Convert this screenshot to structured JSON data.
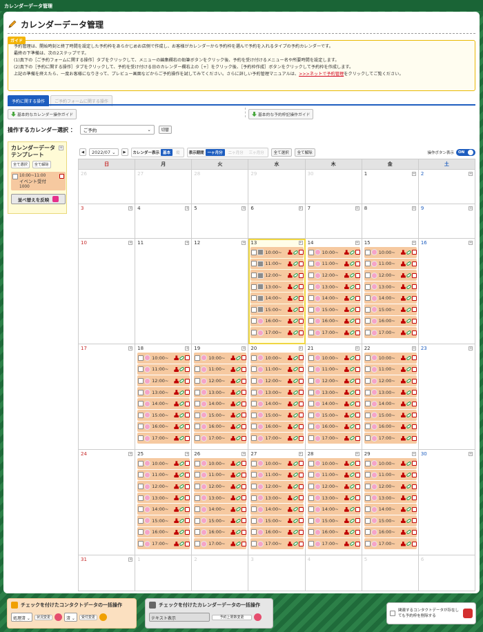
{
  "window": {
    "title": "カレンダーデータ管理"
  },
  "page": {
    "title": "カレンダーデータ管理"
  },
  "guide": {
    "tag": "ガイド",
    "lines": [
      "予約管理は、開始時刻と終了時間を設定した予約枠をあらかじめお店側で作成し、お客様がカレンダーから予約枠を選んで予約を入れるタイプの予約カレンダーです。",
      "最終の下準備は、次の2ステップです。",
      "(1)真下の［ご予約フォームに関する操作］タブをクリックして、メニューの編集欄右の鉛筆ボタンをクリック後、予約を受け付けるメニュー名や所要時間を設定します。",
      "(2)真下の［予約に関する操作］タブをクリックして、予約を受け付ける日のカレンダー欄右上の［+］をクリック後、［予約枠作成］ボタンをクリックして予約枠を作成します。"
    ],
    "last_pre": "上記の準備を終えたら、一度お客様になりきって、プレビュー画面などからご予約操作を試してみてください。さらに詳しい予約管理マニュアルは、",
    "last_link": ">>>ネットで予約管理",
    "last_post": "をクリックしてご覧ください。"
  },
  "tabs": [
    "予約に関する操作",
    "ご予約フォームに関する操作"
  ],
  "guides": {
    "left": "基本的なカレンダー操作ガイド",
    "right": "基本的な予約枠記操作ガイド"
  },
  "calendar_select": {
    "label": "操作するカレンダー選択 ：",
    "value": "ご予約",
    "switch": "切替"
  },
  "template": {
    "title1": "カレンダーデータ",
    "title2": "テンプレート",
    "select_all": "全て選択",
    "deselect_all": "全て解除",
    "item_time": "10:00~11:00",
    "item_name": "イベント受付",
    "item_count": "1000",
    "reflect": "並べ替えを反映"
  },
  "toolbar": {
    "month": "2022/07",
    "display_label": "カレンダー表示",
    "display_basic": "基本",
    "display_alt": "縦",
    "period_label": "表示期間",
    "period_1": "一ヶ月分",
    "period_2": "二ヶ月分",
    "period_3": "三ヶ月分",
    "select_all": "全て選択",
    "deselect_all": "全て解除",
    "op_label": "操作ボタン表示",
    "toggle": "ON"
  },
  "weekdays": [
    "日",
    "月",
    "火",
    "水",
    "木",
    "金",
    "土"
  ],
  "colors": {
    "accent": "#1d5dbf",
    "slot": "#f6c9a0",
    "sunday": "#c62828",
    "saturday": "#1d5dbf"
  },
  "footer": {
    "contact_title": "チェックを付けたコンタクトデータの一括操作",
    "status_sel": "処理済",
    "status_btn": "状況変更",
    "mark_sel": "済",
    "mark_btn": "受付変更",
    "cal_title": "チェックを付けたカレンダーデータの一括操作",
    "text_display": "テキスト表示",
    "upper_limit": "予約上限数変更",
    "note": "関連するコンタクトデータが存在しても予約枠を削除する"
  }
}
